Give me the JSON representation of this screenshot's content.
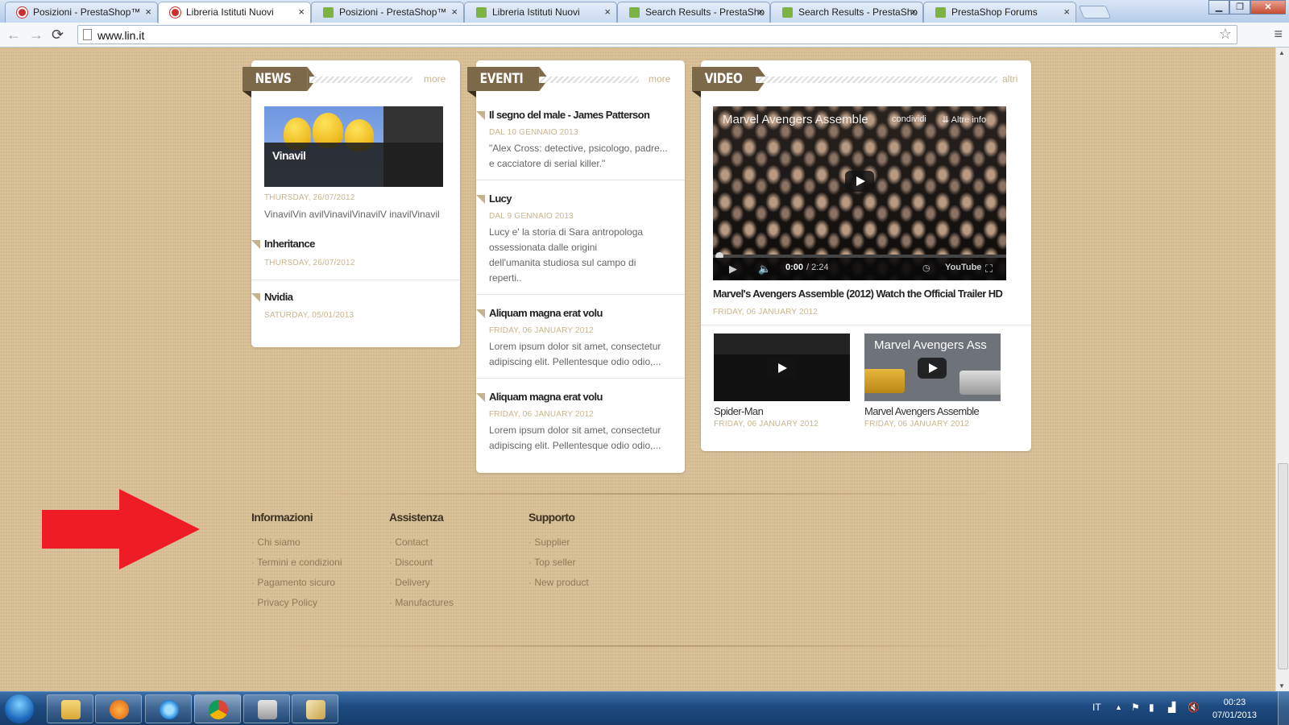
{
  "browser": {
    "tabs": [
      {
        "label": "Posizioni - PrestaShop™",
        "favicon": "prestashop-icon"
      },
      {
        "label": "Libreria Istituti Nuovi",
        "favicon": "prestashop-icon",
        "active": true
      },
      {
        "label": "Posizioni - PrestaShop™",
        "favicon": "leaf-icon"
      },
      {
        "label": "Libreria Istituti Nuovi",
        "favicon": "leaf-icon"
      },
      {
        "label": "Search Results - PrestaSho",
        "favicon": "leaf-icon"
      },
      {
        "label": "Search Results - PrestaSho",
        "favicon": "leaf-icon"
      },
      {
        "label": "PrestaShop Forums",
        "favicon": "leaf-icon"
      }
    ],
    "tab_close": "×",
    "url": "www.lin.it",
    "icons": {
      "back": "back-arrow-icon",
      "forward": "forward-arrow-icon",
      "reload": "reload-icon",
      "bookmark": "star-icon",
      "menu": "wrench-menu-icon"
    }
  },
  "news": {
    "heading": "NEWS",
    "more": "more",
    "featured": {
      "caption": "Vinavil",
      "date": "THURSDAY, 26/07/2012",
      "text": "VinavilVin avilVinavilVinavilV inavilVinavil"
    },
    "items": [
      {
        "title": "Inheritance",
        "date": "THURSDAY, 26/07/2012"
      },
      {
        "title": "Nvidia",
        "date": "SATURDAY, 05/01/2013"
      }
    ]
  },
  "eventi": {
    "heading": "EVENTI",
    "more": "more",
    "items": [
      {
        "title": "Il segno del male - James Patterson",
        "date": "DAL 10 GENNAIO 2013",
        "lines": [
          "\"Alex Cross: detective, psicologo, padre...",
          "e cacciatore di serial killer.\""
        ]
      },
      {
        "title": "Lucy",
        "date": "DAL 9 GENNAIO 2013",
        "lines": [
          "Lucy e' la storia di Sara antropologa",
          "ossessionata dalle origini",
          "dell'umanita studiosa sul campo di",
          "reperti.."
        ]
      },
      {
        "title": "Aliquam magna erat volu",
        "date": "FRIDAY, 06 JANUARY 2012",
        "lines": [
          "Lorem ipsum dolor sit amet, consectetur",
          "adipiscing elit. Pellentesque odio odio,..."
        ]
      },
      {
        "title": "Aliquam magna erat volu",
        "date": "FRIDAY, 06 JANUARY 2012",
        "lines": [
          "Lorem ipsum dolor sit amet, consectetur",
          "adipiscing elit. Pellentesque odio odio,..."
        ]
      }
    ]
  },
  "video": {
    "heading": "VIDEO",
    "more": "altri",
    "player": {
      "title": "Marvel Avengers Assemble",
      "share": "condividi",
      "info": "Altre info",
      "time_current": "0:00",
      "time_total": "/ 2:24",
      "brand": "YouTube"
    },
    "main_title": "Marvel's Avengers Assemble (2012) Watch the Official Trailer HD",
    "main_date": "FRIDAY, 06 JANUARY 2012",
    "thumbs": [
      {
        "title": "Spider-Man",
        "date": "FRIDAY, 06 JANUARY 2012",
        "overlay": ""
      },
      {
        "title": "Marvel Avengers Assemble",
        "date": "FRIDAY, 06 JANUARY 2012",
        "overlay": "Marvel Avengers Ass"
      }
    ]
  },
  "footer": {
    "columns": [
      {
        "heading": "Informazioni",
        "links": [
          "Chi siamo",
          "Termini e condizioni",
          "Pagamento sicuro",
          "Privacy Policy"
        ]
      },
      {
        "heading": "Assistenza",
        "links": [
          "Contact",
          "Discount",
          "Delivery",
          "Manufactures"
        ]
      },
      {
        "heading": "Supporto",
        "links": [
          "Supplier",
          "Top seller",
          "New product"
        ]
      }
    ]
  },
  "annotation": {
    "arrow_color": "#ee1c25"
  },
  "taskbar": {
    "language": "IT",
    "time": "00:23",
    "date": "07/01/2013",
    "apps": [
      "explorer-icon",
      "media-player-icon",
      "internet-explorer-icon",
      "chrome-icon",
      "network-app-icon",
      "paint-icon"
    ]
  },
  "colors": {
    "page_bg": "#d9bf96",
    "ribbon": "#7d6949",
    "accent_text": "#c9b48d"
  }
}
